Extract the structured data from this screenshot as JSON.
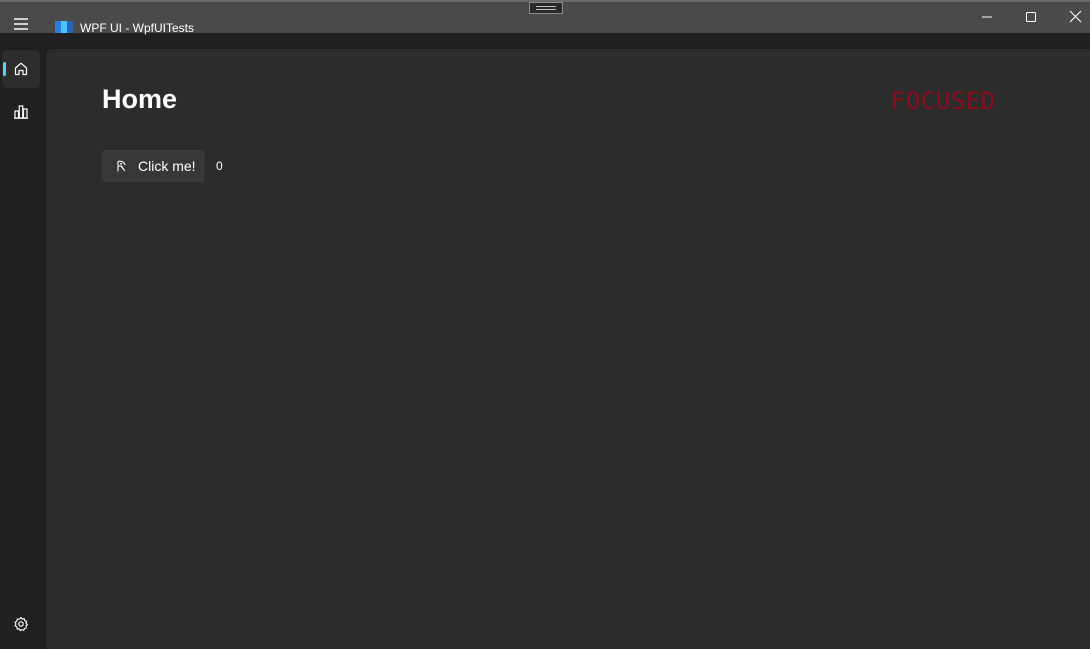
{
  "window": {
    "title": "WPF UI - WpfUITests",
    "colors": {
      "titlebar": "#4a4a4a",
      "background": "#202020",
      "content": "#2c2c2c",
      "accent": "#60cdff",
      "focus_text": "#8b0e1a"
    }
  },
  "titlebar": {
    "menu_icon": "hamburger-menu-icon",
    "logo_icon": "wpf-ui-logo-icon",
    "minimize_icon": "minimize-icon",
    "maximize_icon": "maximize-icon",
    "close_icon": "close-icon"
  },
  "navigation": {
    "items": [
      {
        "id": "home",
        "icon": "home-icon",
        "active": true
      },
      {
        "id": "data",
        "icon": "bar-chart-icon",
        "active": false
      }
    ],
    "footer_items": [
      {
        "id": "settings",
        "icon": "gear-icon",
        "active": false
      }
    ]
  },
  "page": {
    "title": "Home",
    "focus_label": "FOCUSED",
    "button": {
      "label": "Click me!",
      "icon": "fluent-icon"
    },
    "counter": "0"
  }
}
